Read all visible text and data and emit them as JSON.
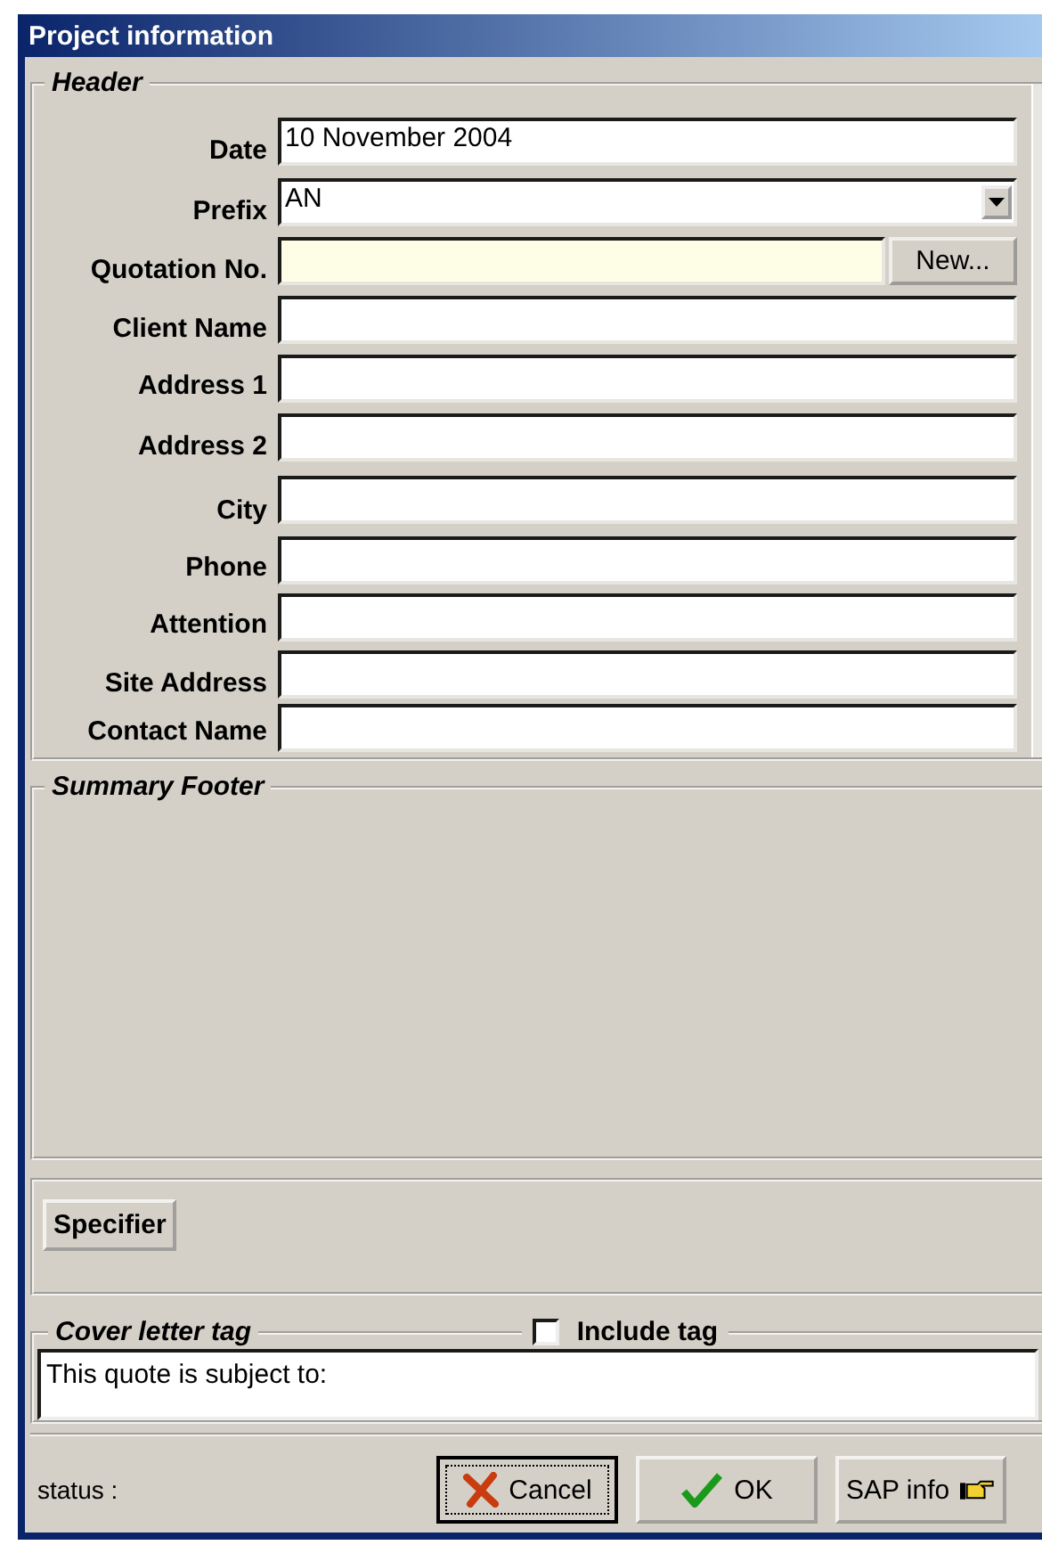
{
  "window": {
    "title": "Project information"
  },
  "header": {
    "title": "Header",
    "fields": [
      {
        "label": "Date",
        "kind": "text",
        "value": "10 November 2004",
        "highlighted": false
      },
      {
        "label": "Prefix",
        "kind": "dropdown",
        "value": "AN",
        "highlighted": false
      },
      {
        "label": "Quotation No.",
        "kind": "text",
        "highlighted": true,
        "button": "New..."
      },
      {
        "label": "Client Name",
        "kind": "text",
        "highlighted": false
      },
      {
        "label": "Address 1",
        "kind": "text",
        "highlighted": false
      },
      {
        "label": "Address 2",
        "kind": "text",
        "highlighted": false
      },
      {
        "label": "City",
        "kind": "text",
        "highlighted": false
      },
      {
        "label": "Phone",
        "kind": "text",
        "highlighted": false
      },
      {
        "label": "Attention",
        "kind": "text",
        "highlighted": false
      },
      {
        "label": "Site Address",
        "kind": "text",
        "highlighted": false
      },
      {
        "label": "Contact Name",
        "kind": "text",
        "highlighted": false
      }
    ]
  },
  "summary_footer": {
    "title": "Summary Footer"
  },
  "specifier_button": "Specifier",
  "cover_letter": {
    "title": "Cover letter tag",
    "include_tag": {
      "label": "Include tag",
      "checked": false
    },
    "text": "This quote is subject to:"
  },
  "status": "status :",
  "buttons": [
    {
      "label": "Cancel",
      "kind": "cancel",
      "focused": true
    },
    {
      "label": "OK",
      "kind": "ok",
      "focused": false
    },
    {
      "label": "SAP info",
      "kind": "info",
      "focused": false
    }
  ]
}
